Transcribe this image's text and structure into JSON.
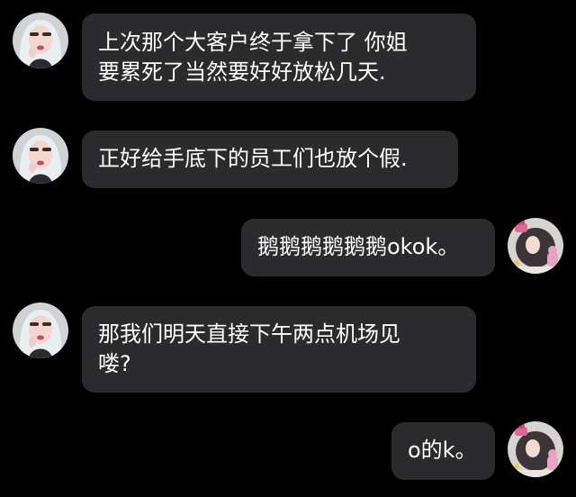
{
  "messages": [
    {
      "side": "left",
      "avatar": "contact-avatar",
      "text": "上次那个大客户终于拿下了 你姐\n要累死了当然要好好放松几天."
    },
    {
      "side": "left",
      "avatar": "contact-avatar",
      "text": "正好给手底下的员工们也放个假."
    },
    {
      "side": "right",
      "avatar": "self-avatar",
      "text": "鹅鹅鹅鹅鹅鹅okok。"
    },
    {
      "side": "left",
      "avatar": "contact-avatar",
      "text": "那我们明天直接下午两点机场见\n喽?"
    },
    {
      "side": "right",
      "avatar": "self-avatar",
      "text": "o的k。"
    }
  ],
  "colors": {
    "background": "#000000",
    "bubble": "#2b2b2d",
    "text": "#ffffff"
  }
}
